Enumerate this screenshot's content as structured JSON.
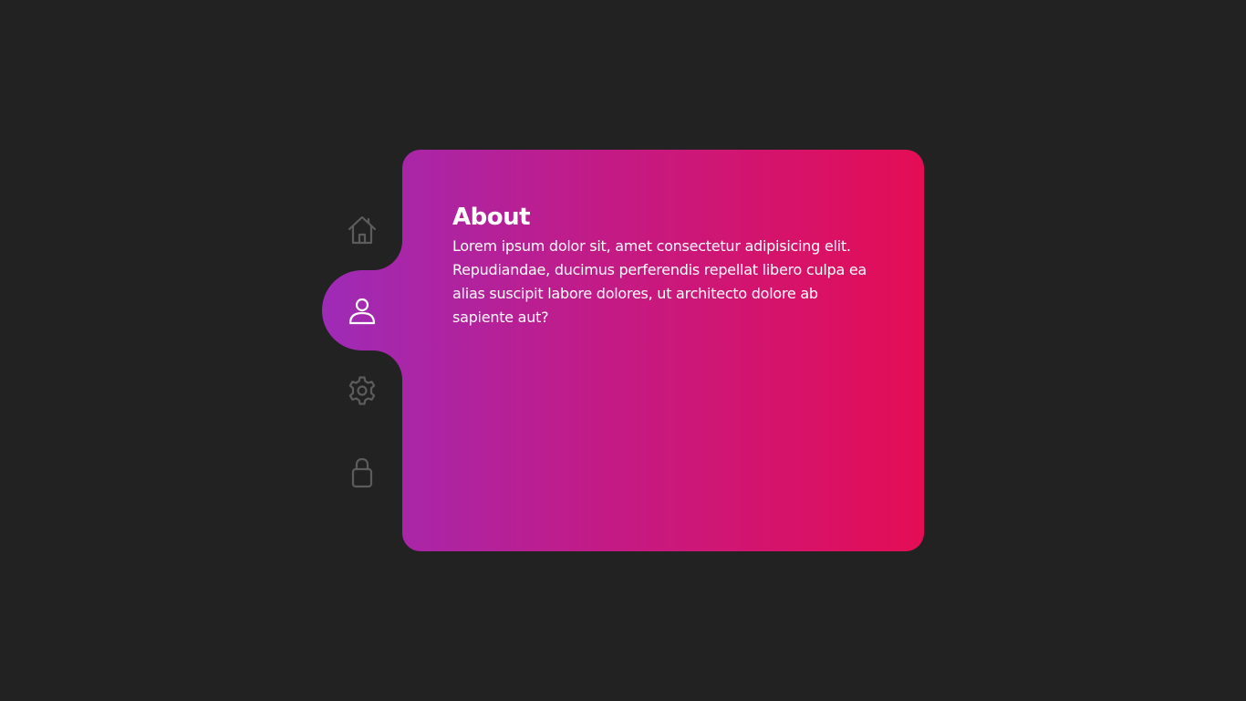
{
  "nav": {
    "items": [
      {
        "id": "home",
        "icon": "home-icon",
        "active": false
      },
      {
        "id": "profile",
        "icon": "user-icon",
        "active": true
      },
      {
        "id": "settings",
        "icon": "gear-icon",
        "active": false
      },
      {
        "id": "security",
        "icon": "lock-icon",
        "active": false
      }
    ],
    "inactive_icon_color": "#5c5c5c",
    "active_icon_color": "#ffffff"
  },
  "panel": {
    "title": "About",
    "body": "Lorem ipsum dolor sit, amet consectetur adipisicing elit. Repudiandae, ducimus perferendis repellat libero culpa ea alias suscipit labore dolores, ut architecto dolore ab sapiente aut?"
  },
  "colors": {
    "background": "#222222",
    "gradient_start": "#9e2bb6",
    "gradient_end": "#e40d55",
    "text": "#ffffff"
  }
}
